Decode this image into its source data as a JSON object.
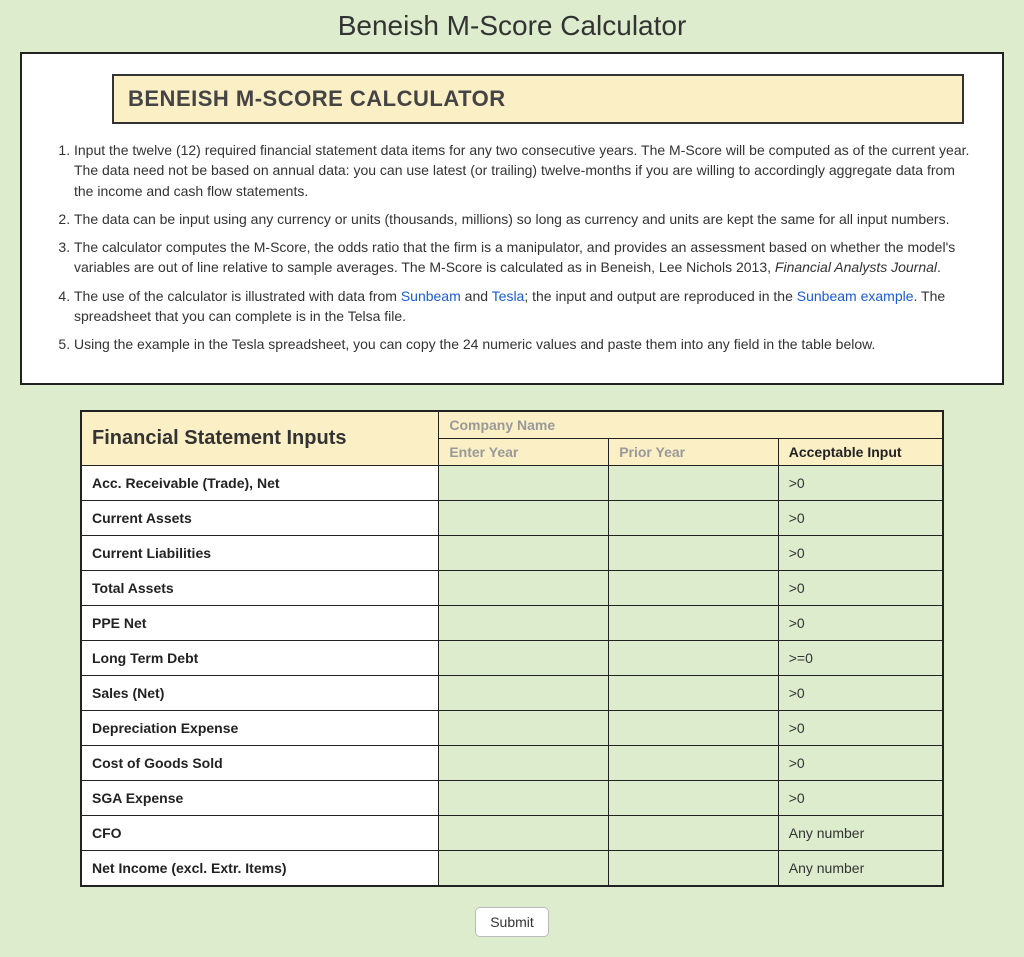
{
  "page_title": "Beneish M-Score Calculator",
  "banner": "BENEISH M-SCORE CALCULATOR",
  "instructions": {
    "item1": "Input the twelve (12) required financial statement data items for any two consecutive years. The M-Score will be computed as of the current year. The data need not be based on annual data: you can use latest (or trailing) twelve-months if you are willing to accordingly aggregate data from the income and cash flow statements.",
    "item2": "The data can be input using any currency or units (thousands, millions) so long as currency and units are kept the same for all input numbers.",
    "item3_a": "The calculator computes the M-Score, the odds ratio that the firm is a manipulator, and provides an assessment based on whether the model's variables are out of line relative to sample averages. The M-Score is calculated as in Beneish, Lee Nichols 2013, ",
    "item3_em": "Financial Analysts Journal",
    "item3_b": ".",
    "item4_a": "The use of the calculator is illustrated with data from ",
    "item4_link1": "Sunbeam",
    "item4_b": " and ",
    "item4_link2": "Tesla",
    "item4_c": "; the input and output are reproduced in the ",
    "item4_link3": "Sunbeam example",
    "item4_d": ". The spreadsheet that you can complete is in the Telsa file.",
    "item5": "Using the example in the Tesla spreadsheet, you can copy the 24 numeric values and paste them into any field in the table below."
  },
  "table": {
    "header_title": "Financial Statement Inputs",
    "company_placeholder": "Company Name",
    "year_placeholder": "Enter Year",
    "prior_placeholder": "Prior Year",
    "acceptable_header": "Acceptable Input",
    "rows": [
      {
        "label": "Acc. Receivable (Trade), Net",
        "acc": ">0"
      },
      {
        "label": "Current Assets",
        "acc": ">0"
      },
      {
        "label": "Current Liabilities",
        "acc": ">0"
      },
      {
        "label": "Total Assets",
        "acc": ">0"
      },
      {
        "label": "PPE Net",
        "acc": ">0"
      },
      {
        "label": "Long Term Debt",
        "acc": ">=0"
      },
      {
        "label": "Sales (Net)",
        "acc": ">0"
      },
      {
        "label": "Depreciation Expense",
        "acc": ">0"
      },
      {
        "label": "Cost of Goods Sold",
        "acc": ">0"
      },
      {
        "label": "SGA Expense",
        "acc": ">0"
      },
      {
        "label": "CFO",
        "acc": "Any number"
      },
      {
        "label": "Net Income (excl. Extr. Items)",
        "acc": "Any number"
      }
    ]
  },
  "submit_label": "Submit"
}
